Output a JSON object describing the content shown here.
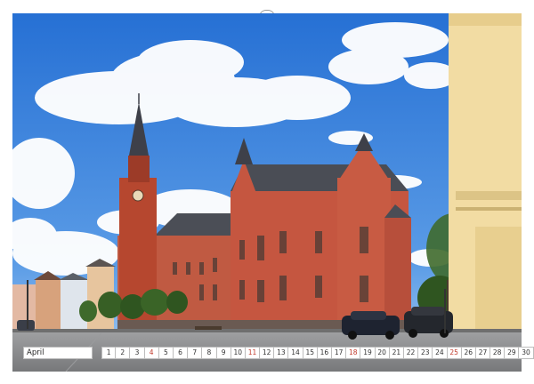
{
  "calendar": {
    "month": "April",
    "days": [
      "1",
      "2",
      "3",
      "4",
      "5",
      "6",
      "7",
      "8",
      "9",
      "10",
      "11",
      "12",
      "13",
      "14",
      "15",
      "16",
      "17",
      "18",
      "19",
      "20",
      "21",
      "22",
      "23",
      "24",
      "25",
      "26",
      "27",
      "28",
      "29",
      "30"
    ],
    "sunday_days": [
      "4",
      "11",
      "18",
      "25"
    ]
  },
  "colors": {
    "sky_top": "#2b78d8",
    "sky_bottom": "#7fb4ea",
    "brick": "#c2553f",
    "roof": "#4a4d55",
    "tower": "#b5452f",
    "street": "#8e8f91",
    "right_building": "#f3dfa6",
    "sunday_text": "#c0392b"
  }
}
